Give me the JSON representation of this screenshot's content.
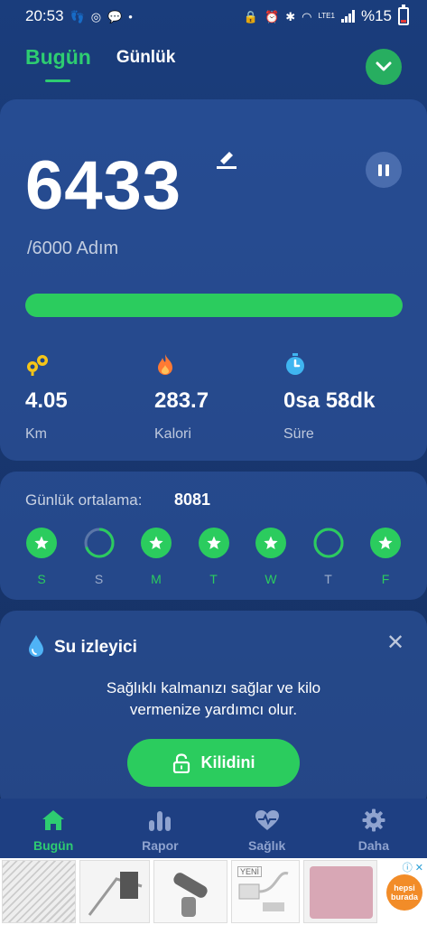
{
  "status_bar": {
    "time": "20:53",
    "battery_text": "%15",
    "network": "LTE1"
  },
  "tabs": {
    "today": "Bugün",
    "daily": "Günlük"
  },
  "steps": {
    "count": "6433",
    "goal": "/6000 Adım",
    "progress_fraction": 1.0
  },
  "stats": [
    {
      "value": "4.05",
      "unit": "Km",
      "icon": "footprints-icon"
    },
    {
      "value": "283.7",
      "unit": "Kalori",
      "icon": "flame-icon"
    },
    {
      "value": "0sa 58dk",
      "unit": "Süre",
      "icon": "stopwatch-icon"
    }
  ],
  "daily_average": {
    "label": "Günlük ortalama:",
    "value": "8081",
    "days": [
      {
        "label": "S",
        "achieved": true
      },
      {
        "label": "S",
        "achieved": false,
        "partial": 0.7
      },
      {
        "label": "M",
        "achieved": true
      },
      {
        "label": "T",
        "achieved": true
      },
      {
        "label": "W",
        "achieved": true
      },
      {
        "label": "T",
        "achieved": false,
        "partial": 1.0
      },
      {
        "label": "F",
        "achieved": true
      }
    ]
  },
  "water": {
    "title": "Su izleyici",
    "desc_line1": "Sağlıklı kalmanızı sağlar ve kilo",
    "desc_line2": "vermenize yardımcı olur.",
    "unlock_label": "Kilidini"
  },
  "nav": [
    {
      "label": "Bugün",
      "icon": "home-icon",
      "active": true
    },
    {
      "label": "Rapor",
      "icon": "bar-chart-icon",
      "active": false
    },
    {
      "label": "Sağlık",
      "icon": "heart-pulse-icon",
      "active": false
    },
    {
      "label": "Daha",
      "icon": "gear-icon",
      "active": false
    }
  ],
  "ad": {
    "logo_line1": "hepsi",
    "logo_line2": "burada",
    "yeni": "YENİ"
  },
  "colors": {
    "accent": "#2bcc5e",
    "background": "#1a3d7c",
    "inactive_nav": "#8fa3cf"
  }
}
